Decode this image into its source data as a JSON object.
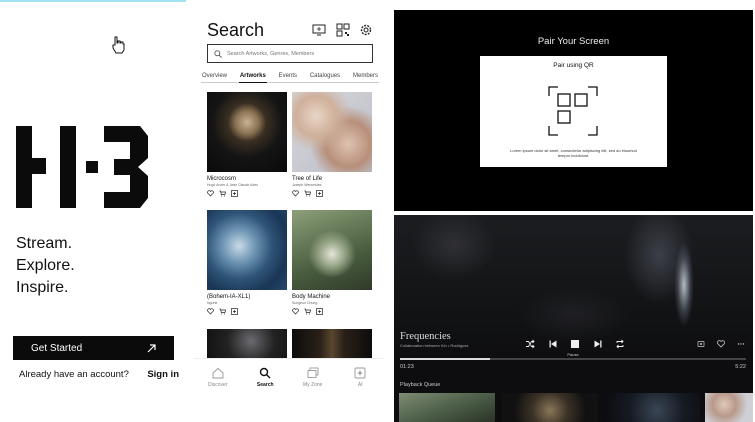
{
  "welcome": {
    "taglines": [
      "Stream.",
      "Explore.",
      "Inspire."
    ],
    "cta_label": "Get Started",
    "account_prompt": "Already have an account?",
    "signin_label": "Sign in"
  },
  "search": {
    "title": "Search",
    "placeholder": "Search Artworks, Genres, Members",
    "tabs": [
      "Overview",
      "Artworks",
      "Events",
      "Catalogues",
      "Members"
    ],
    "active_tab": "Artworks",
    "cards": [
      {
        "title": "Microcosm",
        "subtitle": "Hugo Arcier & Jean Claude Ades"
      },
      {
        "title": "Tree of Life",
        "subtitle": "Joseph Wenceslas"
      },
      {
        "title": "(Bohem-IA-XL1)",
        "subtitle": "Ngurte"
      },
      {
        "title": "Body Machine",
        "subtitle": "Sungeun Chung"
      }
    ],
    "nav": [
      "Discover",
      "Search",
      "My Zone",
      "AI"
    ],
    "active_nav": "Search"
  },
  "pair": {
    "title": "Pair Your Screen",
    "card_title": "Pair using QR",
    "description": "Lorem ipsum dolor sit amet, consectetur adipiscing elit, sed do eiusmod tempor incididunt."
  },
  "player": {
    "track_title": "Frequencies",
    "track_subtitle": "Collaboration between Kin • Rodriguez",
    "pause_label": "Pause",
    "time_elapsed": "01:23",
    "time_total": "5:22",
    "progress": 0.26,
    "queue_label": "Playback Queue"
  }
}
